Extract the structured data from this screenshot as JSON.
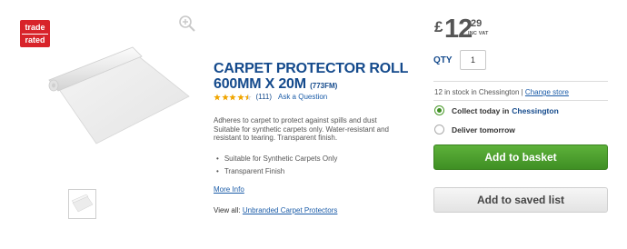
{
  "badge": {
    "line1": "trade",
    "line2": "rated"
  },
  "product": {
    "title": "CARPET PROTECTOR ROLL 600MM X 20M",
    "code": "(773FM)",
    "rating_stars": 4.5,
    "rating_max": 5,
    "review_count": "(111)",
    "ask_question": "Ask a Question",
    "description": "Adheres to carpet to protect against spills and dust  Suitable for synthetic carpets only. Water-resistant and resistant to tearing. Transparent finish.",
    "bullets": [
      "Suitable for Synthetic Carpets Only",
      "Transparent Finish"
    ],
    "more_info": "More Info",
    "view_all_label": "View all:",
    "view_all_link": "Unbranded Carpet Protectors"
  },
  "price": {
    "currency": "£",
    "whole": "12",
    "decimal": ".29",
    "vat": "INC VAT"
  },
  "quantity": {
    "label": "QTY",
    "value": "1"
  },
  "stock": {
    "text": "12 in stock in Chessington | ",
    "change_store": "Change store"
  },
  "delivery_options": [
    {
      "label": "Collect today in",
      "location": "Chessington",
      "selected": true
    },
    {
      "label": "Deliver tomorrow",
      "location": "",
      "selected": false
    }
  ],
  "buttons": {
    "add_to_basket": "Add to basket",
    "add_to_saved": "Add to saved list"
  },
  "colors": {
    "brand_blue": "#144a8c",
    "link_blue": "#1b5ca8",
    "basket_green": "#4aa02c",
    "badge_red": "#d8232a",
    "star_gold": "#f0a500"
  }
}
